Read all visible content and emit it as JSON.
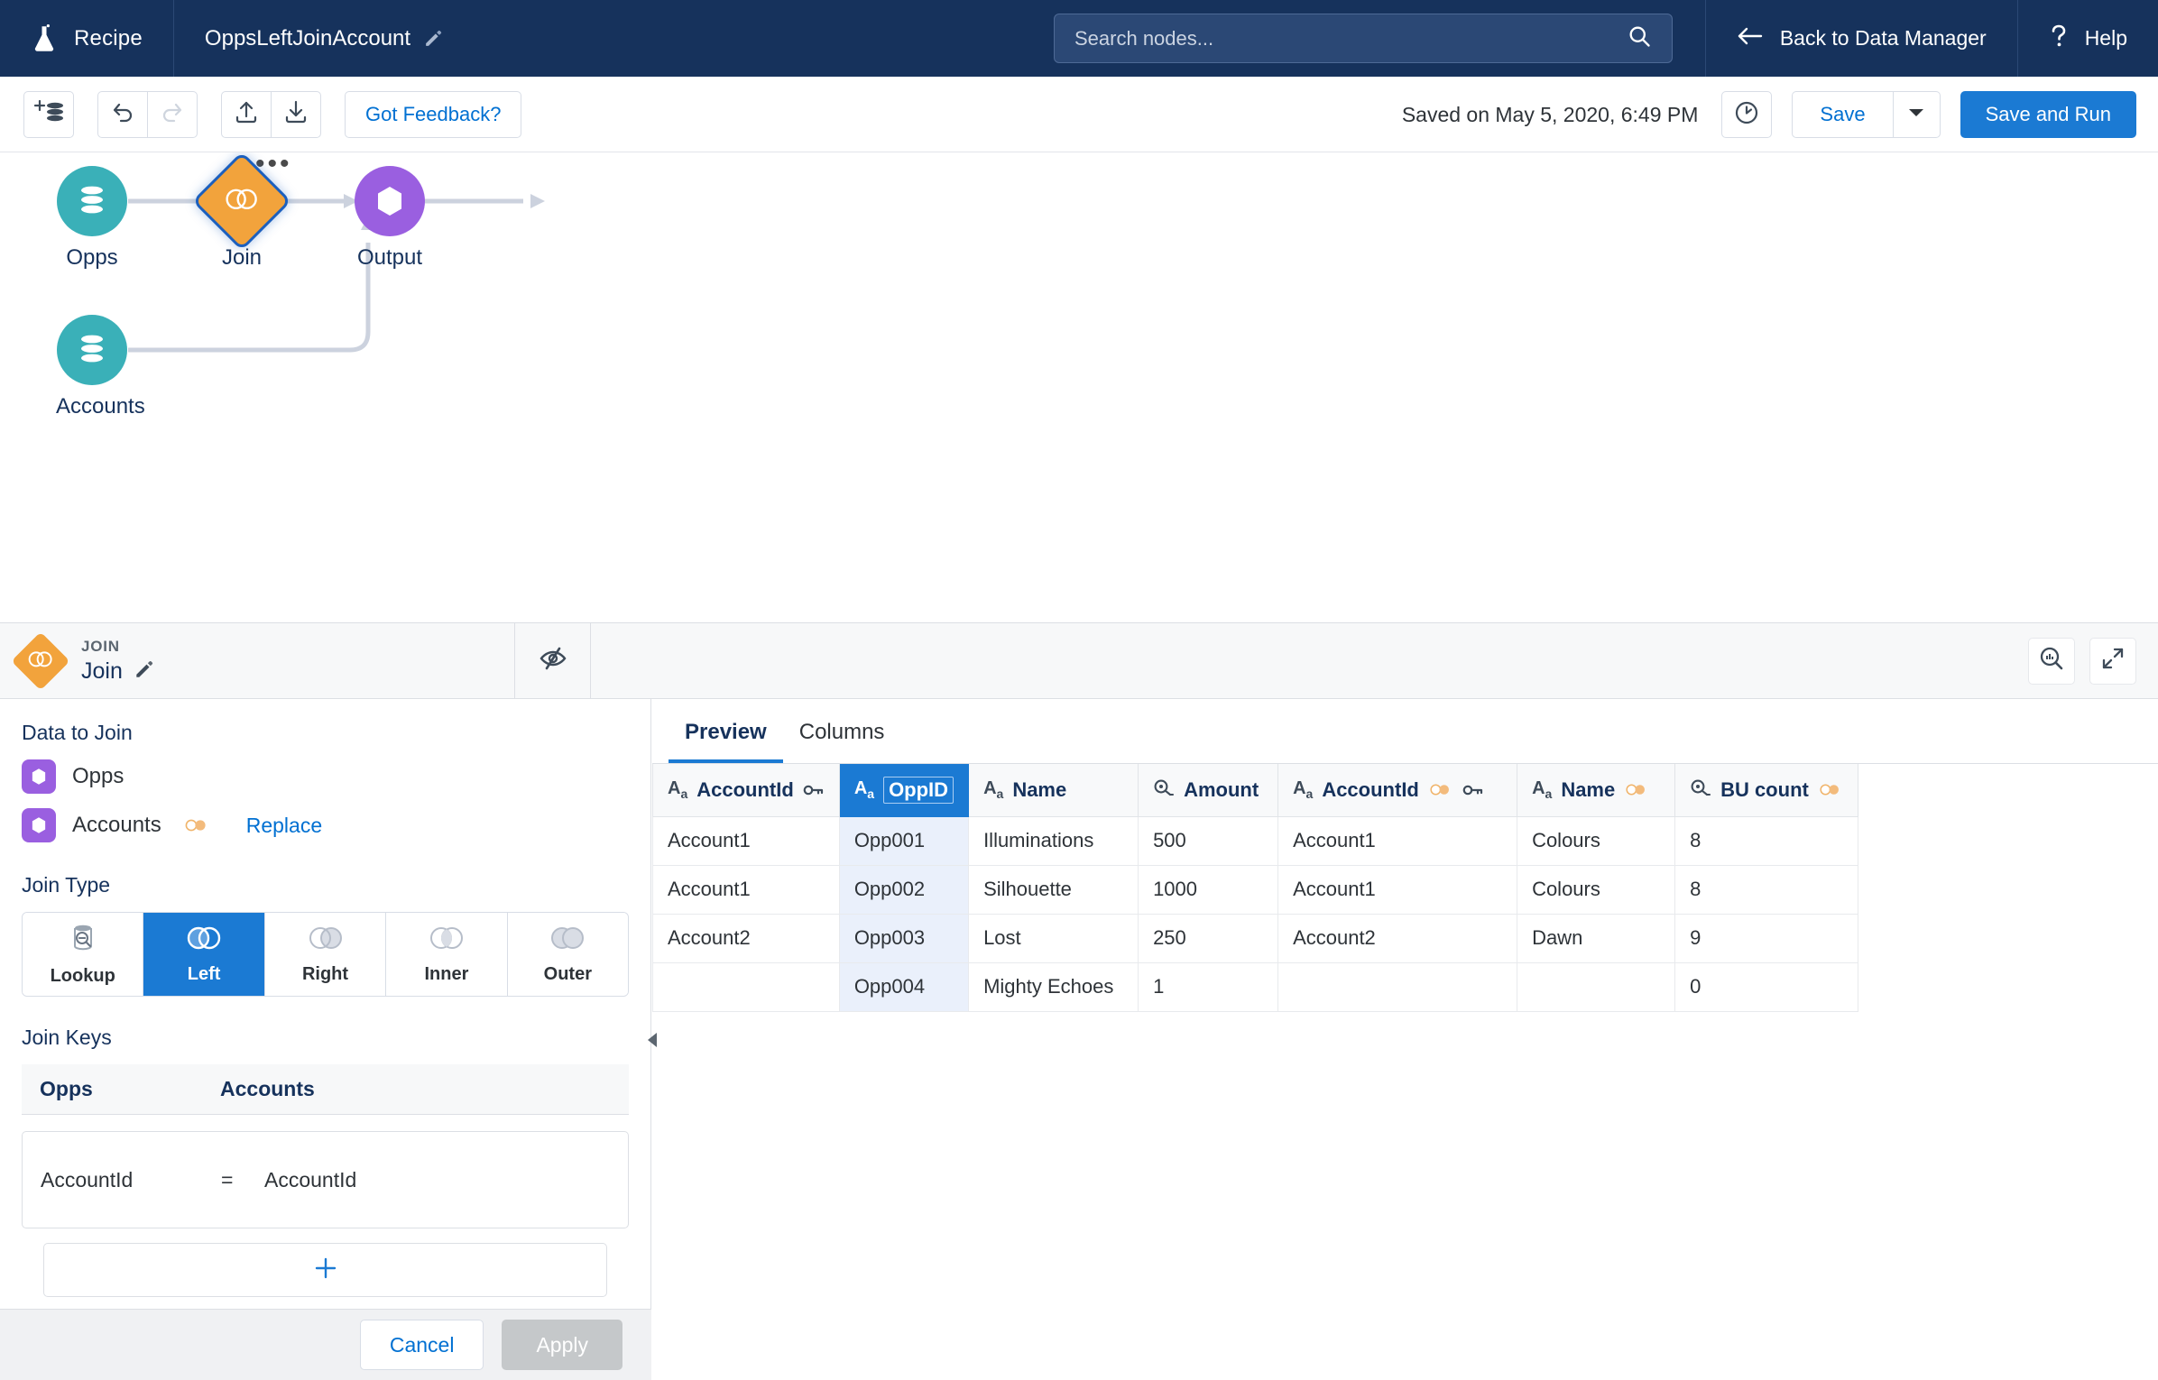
{
  "topnav": {
    "recipe_label": "Recipe",
    "recipe_icon": "flask-icon",
    "title": "OppsLeftJoinAccount",
    "title_edit_icon": "pencil-icon",
    "search_placeholder": "Search nodes...",
    "search_value": "",
    "search_icon": "search-icon",
    "back_label": "Back to Data Manager",
    "back_icon": "arrow-left-icon",
    "help_label": "Help",
    "help_icon": "question-mark-icon",
    "bg_color": "#16325c"
  },
  "toolbar": {
    "add_data_icon": "add-dataset-icon",
    "undo_icon": "undo-icon",
    "redo_icon": "redo-icon",
    "upload_icon": "upload-icon",
    "download_icon": "download-icon",
    "feedback_label": "Got Feedback?",
    "saved_text": "Saved on May 5, 2020, 6:49 PM",
    "schedule_icon": "clock-icon",
    "save_label": "Save",
    "save_caret_icon": "chevron-down-icon",
    "save_and_run_label": "Save and Run",
    "accent_color": "#1b7ad3"
  },
  "graph": {
    "nodes": [
      {
        "id": "opps",
        "label": "Opps",
        "icon": "database-icon",
        "color": "#3ab0b8"
      },
      {
        "id": "join",
        "label": "Join",
        "icon": "join-icon",
        "color": "#f2a33c"
      },
      {
        "id": "output",
        "label": "Output",
        "icon": "output-icon",
        "color": "#9a5fe0"
      },
      {
        "id": "accounts",
        "label": "Accounts",
        "icon": "database-icon",
        "color": "#3ab0b8"
      }
    ],
    "node_menu_icon": "ellipsis-icon"
  },
  "panel_header": {
    "kind": "JOIN",
    "name": "Join",
    "edit_icon": "pencil-icon",
    "preview_toggle_icon": "eye-slash-icon",
    "inspect_icon": "magnifier-chart-icon",
    "expand_icon": "expand-icon"
  },
  "config": {
    "data_to_join_label": "Data to Join",
    "sources": [
      {
        "name": "Opps",
        "icon": "dataset-icon",
        "has_join_badge": false,
        "action": ""
      },
      {
        "name": "Accounts",
        "icon": "dataset-icon",
        "has_join_badge": true,
        "action": "Replace"
      }
    ],
    "join_type_label": "Join Type",
    "join_types": [
      {
        "label": "Lookup",
        "icon": "lookup-icon",
        "selected": false
      },
      {
        "label": "Left",
        "icon": "left-join-icon",
        "selected": true
      },
      {
        "label": "Right",
        "icon": "right-join-icon",
        "selected": false
      },
      {
        "label": "Inner",
        "icon": "inner-join-icon",
        "selected": false
      },
      {
        "label": "Outer",
        "icon": "outer-join-icon",
        "selected": false
      }
    ],
    "join_keys_label": "Join Keys",
    "join_keys_headers": [
      "Opps",
      "Accounts"
    ],
    "join_keys_rows": [
      {
        "left": "AccountId",
        "operator": "=",
        "right": "AccountId"
      }
    ],
    "add_key_icon": "plus-icon",
    "cancel_label": "Cancel",
    "apply_label": "Apply",
    "collapse_icon": "chevron-left-icon"
  },
  "preview": {
    "tabs": [
      {
        "label": "Preview",
        "active": true
      },
      {
        "label": "Columns",
        "active": false
      }
    ],
    "columns": [
      {
        "name": "AccountId",
        "type_icon": "text-type-icon",
        "key_icon": true,
        "join_badge": false,
        "selected": false
      },
      {
        "name": "OppID",
        "type_icon": "text-type-icon",
        "key_icon": false,
        "join_badge": false,
        "selected": true
      },
      {
        "name": "Name",
        "type_icon": "text-type-icon",
        "key_icon": false,
        "join_badge": false,
        "selected": false
      },
      {
        "name": "Amount",
        "type_icon": "measure-type-icon",
        "key_icon": false,
        "join_badge": false,
        "selected": false
      },
      {
        "name": "AccountId",
        "type_icon": "text-type-icon",
        "key_icon": true,
        "join_badge": true,
        "selected": false
      },
      {
        "name": "Name",
        "type_icon": "text-type-icon",
        "key_icon": false,
        "join_badge": true,
        "selected": false
      },
      {
        "name": "BU count",
        "type_icon": "measure-type-icon",
        "key_icon": false,
        "join_badge": true,
        "selected": false
      }
    ],
    "rows": [
      [
        "Account1",
        "Opp001",
        "Illuminations",
        "500",
        "Account1",
        "Colours",
        "8"
      ],
      [
        "Account1",
        "Opp002",
        "Silhouette",
        "1000",
        "Account1",
        "Colours",
        "8"
      ],
      [
        "Account2",
        "Opp003",
        "Lost",
        "250",
        "Account2",
        "Dawn",
        "9"
      ],
      [
        "",
        "Opp004",
        "Mighty Echoes",
        "1",
        "",
        "",
        "0"
      ]
    ]
  }
}
